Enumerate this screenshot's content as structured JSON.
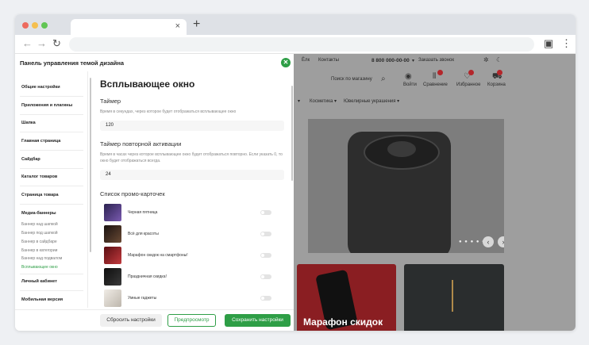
{
  "colors": {
    "accent": "#2e9e46",
    "badge": "#b3262b",
    "chrome": "#dee1e6"
  },
  "browser": {
    "tab_close": "×",
    "new_tab": "+",
    "icons": {
      "back": "arrow-left-icon",
      "forward": "arrow-right-icon",
      "reload": "reload-icon",
      "menu": "more-vert-icon"
    }
  },
  "site": {
    "links": [
      "Ёлк",
      "Контакты"
    ],
    "phone": "8 800 000-00-00",
    "phone_extra": "▾",
    "callback": "Заказать звонок",
    "search": "Поиск по магазину",
    "header_icons": [
      {
        "icon": "user-icon",
        "label": "Войти"
      },
      {
        "icon": "compare-icon",
        "label": "Сравнение"
      },
      {
        "icon": "heart-icon",
        "label": "Избранное"
      },
      {
        "icon": "cart-icon",
        "label": "Корзина"
      }
    ],
    "menu": [
      "Косметика ▾",
      "Ювелирные украшения ▾"
    ],
    "menu_left": "▾",
    "card_title": "Марафон скидок"
  },
  "panel": {
    "title": "Панель управления темой дизайна",
    "close": "✕",
    "sidebar": [
      "Общие настройки",
      "Приложения и плагины",
      "Шапка",
      "Главная страница",
      "Сайдбар",
      "Каталог товаров",
      "Страница товара",
      "Медиа-баннеры"
    ],
    "sidebar_sub": [
      {
        "label": "Баннер над шапкой",
        "active": false
      },
      {
        "label": "Баннер под шапкой",
        "active": false
      },
      {
        "label": "Баннер в сайдбаре",
        "active": false
      },
      {
        "label": "Баннер в категории",
        "active": false
      },
      {
        "label": "Баннер над подвалом",
        "active": false
      },
      {
        "label": "Всплывающее окно",
        "active": true
      }
    ],
    "sidebar_after": [
      "Личный кабинет",
      "Мобильная версия"
    ],
    "content": {
      "title": "Всплывающее окно",
      "timer_label": "Таймер",
      "timer_hint": "Время в секундах, через которое будет отображаться всплывающее окно",
      "timer_value": "120",
      "reactivation_label": "Таймер повторной активации",
      "reactivation_hint": "Время в часах через которое всплывающее окно будет отображаться повторно. Если указать 0, то окно будет отображаться всегда.",
      "reactivation_value": "24",
      "promo_label": "Список промо-карточек",
      "promo_cards": [
        {
          "label": "Черная пятница",
          "color": "#4a3a7a"
        },
        {
          "label": "Всё для красоты",
          "color": "#3a2a22"
        },
        {
          "label": "Марафон скидок на смартфоны!",
          "color": "#8a1e22"
        },
        {
          "label": "Праздничная скидка!",
          "color": "#1e1e1e"
        },
        {
          "label": "Умные гаджеты",
          "color": "#d8d4ce"
        }
      ]
    },
    "buttons": {
      "reset": "Сбросить настройки",
      "preview": "Предпросмотр",
      "save": "Сохранить настройки"
    }
  }
}
